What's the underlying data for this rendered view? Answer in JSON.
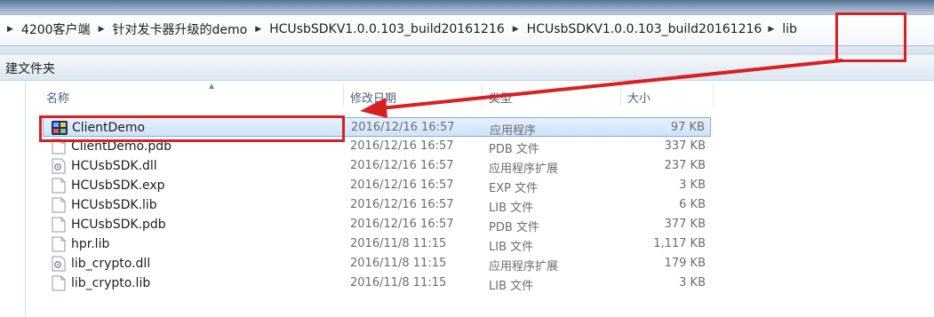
{
  "breadcrumb": [
    {
      "label": "4200客户端"
    },
    {
      "label": "针对发卡器升级的demo"
    },
    {
      "label": "HCUsbSDKV1.0.0.103_build20161216"
    },
    {
      "label": "HCUsbSDKV1.0.0.103_build20161216"
    },
    {
      "label": "lib"
    }
  ],
  "toolbar": {
    "new_folder_label": "建文件夹"
  },
  "columns": {
    "name": "名称",
    "date": "修改日期",
    "type": "类型",
    "size": "大小"
  },
  "files": [
    {
      "name": "ClientDemo",
      "date": "2016/12/16 16:57",
      "type": "应用程序",
      "size": "97 KB",
      "icon": "app-icon"
    },
    {
      "name": "ClientDemo.pdb",
      "date": "2016/12/16 16:57",
      "type": "PDB 文件",
      "size": "337 KB",
      "icon": "file-icon"
    },
    {
      "name": "HCUsbSDK.dll",
      "date": "2016/12/16 16:57",
      "type": "应用程序扩展",
      "size": "237 KB",
      "icon": "dll-icon"
    },
    {
      "name": "HCUsbSDK.exp",
      "date": "2016/12/16 16:57",
      "type": "EXP 文件",
      "size": "3 KB",
      "icon": "file-icon"
    },
    {
      "name": "HCUsbSDK.lib",
      "date": "2016/12/16 16:57",
      "type": "LIB 文件",
      "size": "6 KB",
      "icon": "file-icon"
    },
    {
      "name": "HCUsbSDK.pdb",
      "date": "2016/12/16 16:57",
      "type": "PDB 文件",
      "size": "377 KB",
      "icon": "file-icon"
    },
    {
      "name": "hpr.lib",
      "date": "2016/11/8 11:15",
      "type": "LIB 文件",
      "size": "1,117 KB",
      "icon": "file-icon"
    },
    {
      "name": "lib_crypto.dll",
      "date": "2016/11/8 11:15",
      "type": "应用程序扩展",
      "size": "179 KB",
      "icon": "dll-icon"
    },
    {
      "name": "lib_crypto.lib",
      "date": "2016/11/8 11:15",
      "type": "LIB 文件",
      "size": "3 KB",
      "icon": "file-icon"
    }
  ],
  "colors": {
    "annotation": "#d92020",
    "selection": "#cfe3fb"
  }
}
